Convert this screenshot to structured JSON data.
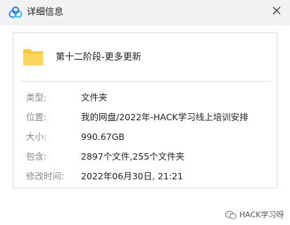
{
  "window": {
    "title": "详细信息",
    "logo_icon": "baidu-netdisk-cloud-icon",
    "close_icon": "close-icon",
    "accent": "#3a8ff7"
  },
  "file": {
    "icon": "folder-icon",
    "folder_color": "#f9c53a",
    "name": "第十二阶段-更多更新"
  },
  "details": [
    {
      "label": "类型:",
      "value": "文件夹"
    },
    {
      "label": "位置:",
      "value": "我的网盘/2022年-HACK学习线上培训安排"
    },
    {
      "label": "大小:",
      "value": "990.67GB"
    },
    {
      "label": "包含:",
      "value": "2897个文件,255个文件夹"
    },
    {
      "label": "修改时间:",
      "value": "2022年06月30日, 21:21"
    }
  ],
  "watermark": {
    "icon": "wechat-icon",
    "text": "HACK学习呀"
  }
}
